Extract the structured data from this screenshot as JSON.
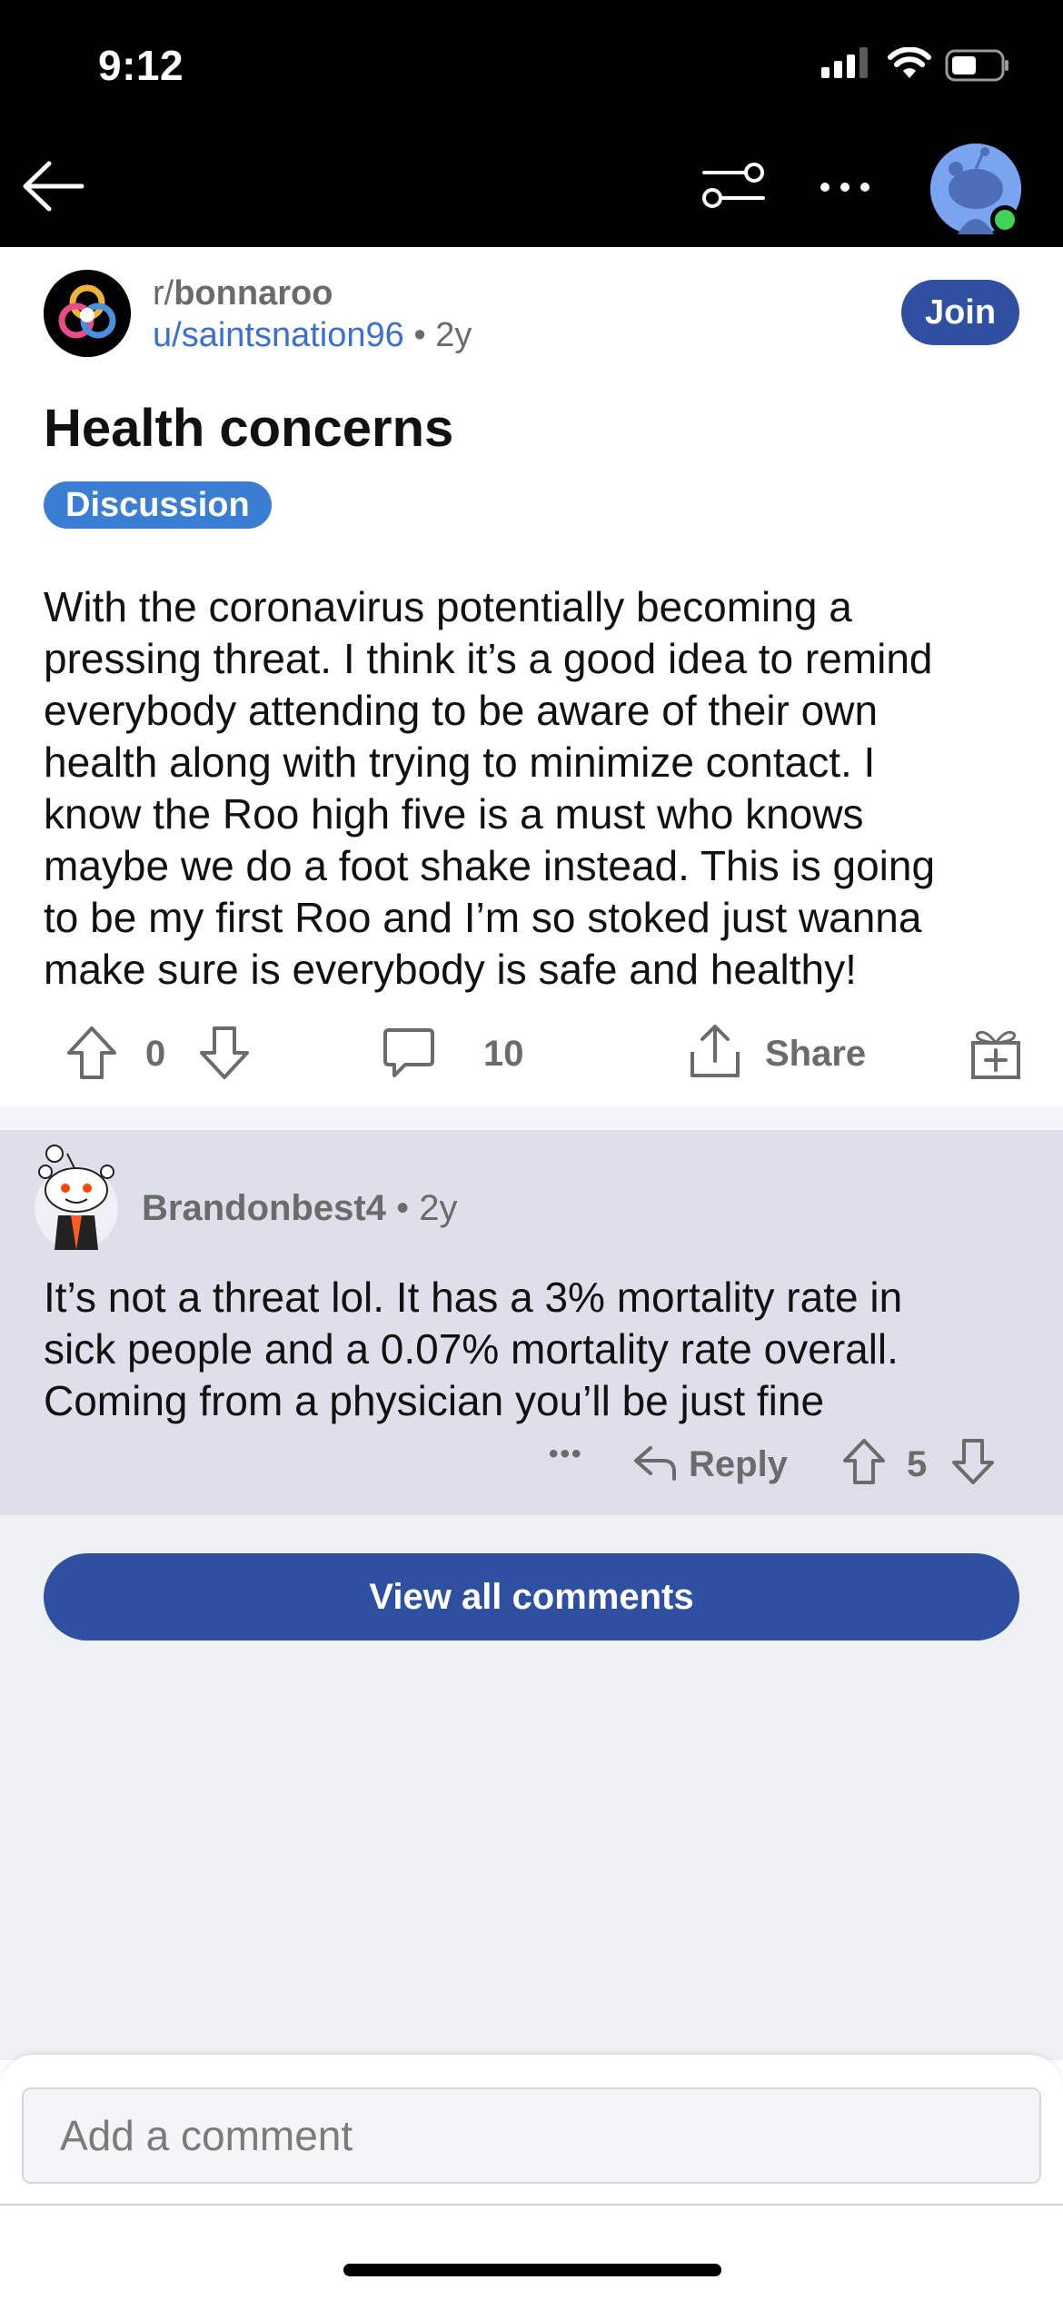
{
  "status_bar": {
    "time": "9:12"
  },
  "header": {
    "back_icon": "arrow-left-icon",
    "filter_icon": "sort-sliders-icon",
    "more_icon": "more-horizontal-icon",
    "avatar_icon": "snoo-avatar-icon",
    "online_color": "#3fd35a"
  },
  "post": {
    "subreddit_prefix": "r/",
    "subreddit": "bonnaroo",
    "author": "u/saintsnation96",
    "separator": "•",
    "age": "2y",
    "join_label": "Join",
    "title": "Health concerns",
    "flair": "Discussion",
    "body": "With the coronavirus potentially becoming a\npressing threat. I think it’s a good idea to remind\neverybody attending to be aware of their own\nhealth along with trying to minimize contact. I\nknow the Roo high five is a must who knows\nmaybe we do a foot shake instead. This is going\nto be my first Roo and I’m so stoked just wanna\nmake sure is everybody is safe and healthy!",
    "score": "0",
    "comments": "10",
    "share_label": "Share"
  },
  "comment": {
    "author": "Brandonbest4",
    "separator": "•",
    "age": "2y",
    "body": "It’s not a threat lol. It has a 3% mortality rate in\nsick people and a 0.07% mortality rate overall.\nComing from a physician you’ll be just fine",
    "more": "•••",
    "reply_label": "Reply",
    "score": "5"
  },
  "view_all_label": "View all comments",
  "composer": {
    "placeholder": "Add a comment"
  },
  "colors": {
    "accent": "#2f4fa0",
    "flair": "#3a7ed3",
    "link": "#3b6fd1",
    "comment_bg": "#dde0ea"
  }
}
